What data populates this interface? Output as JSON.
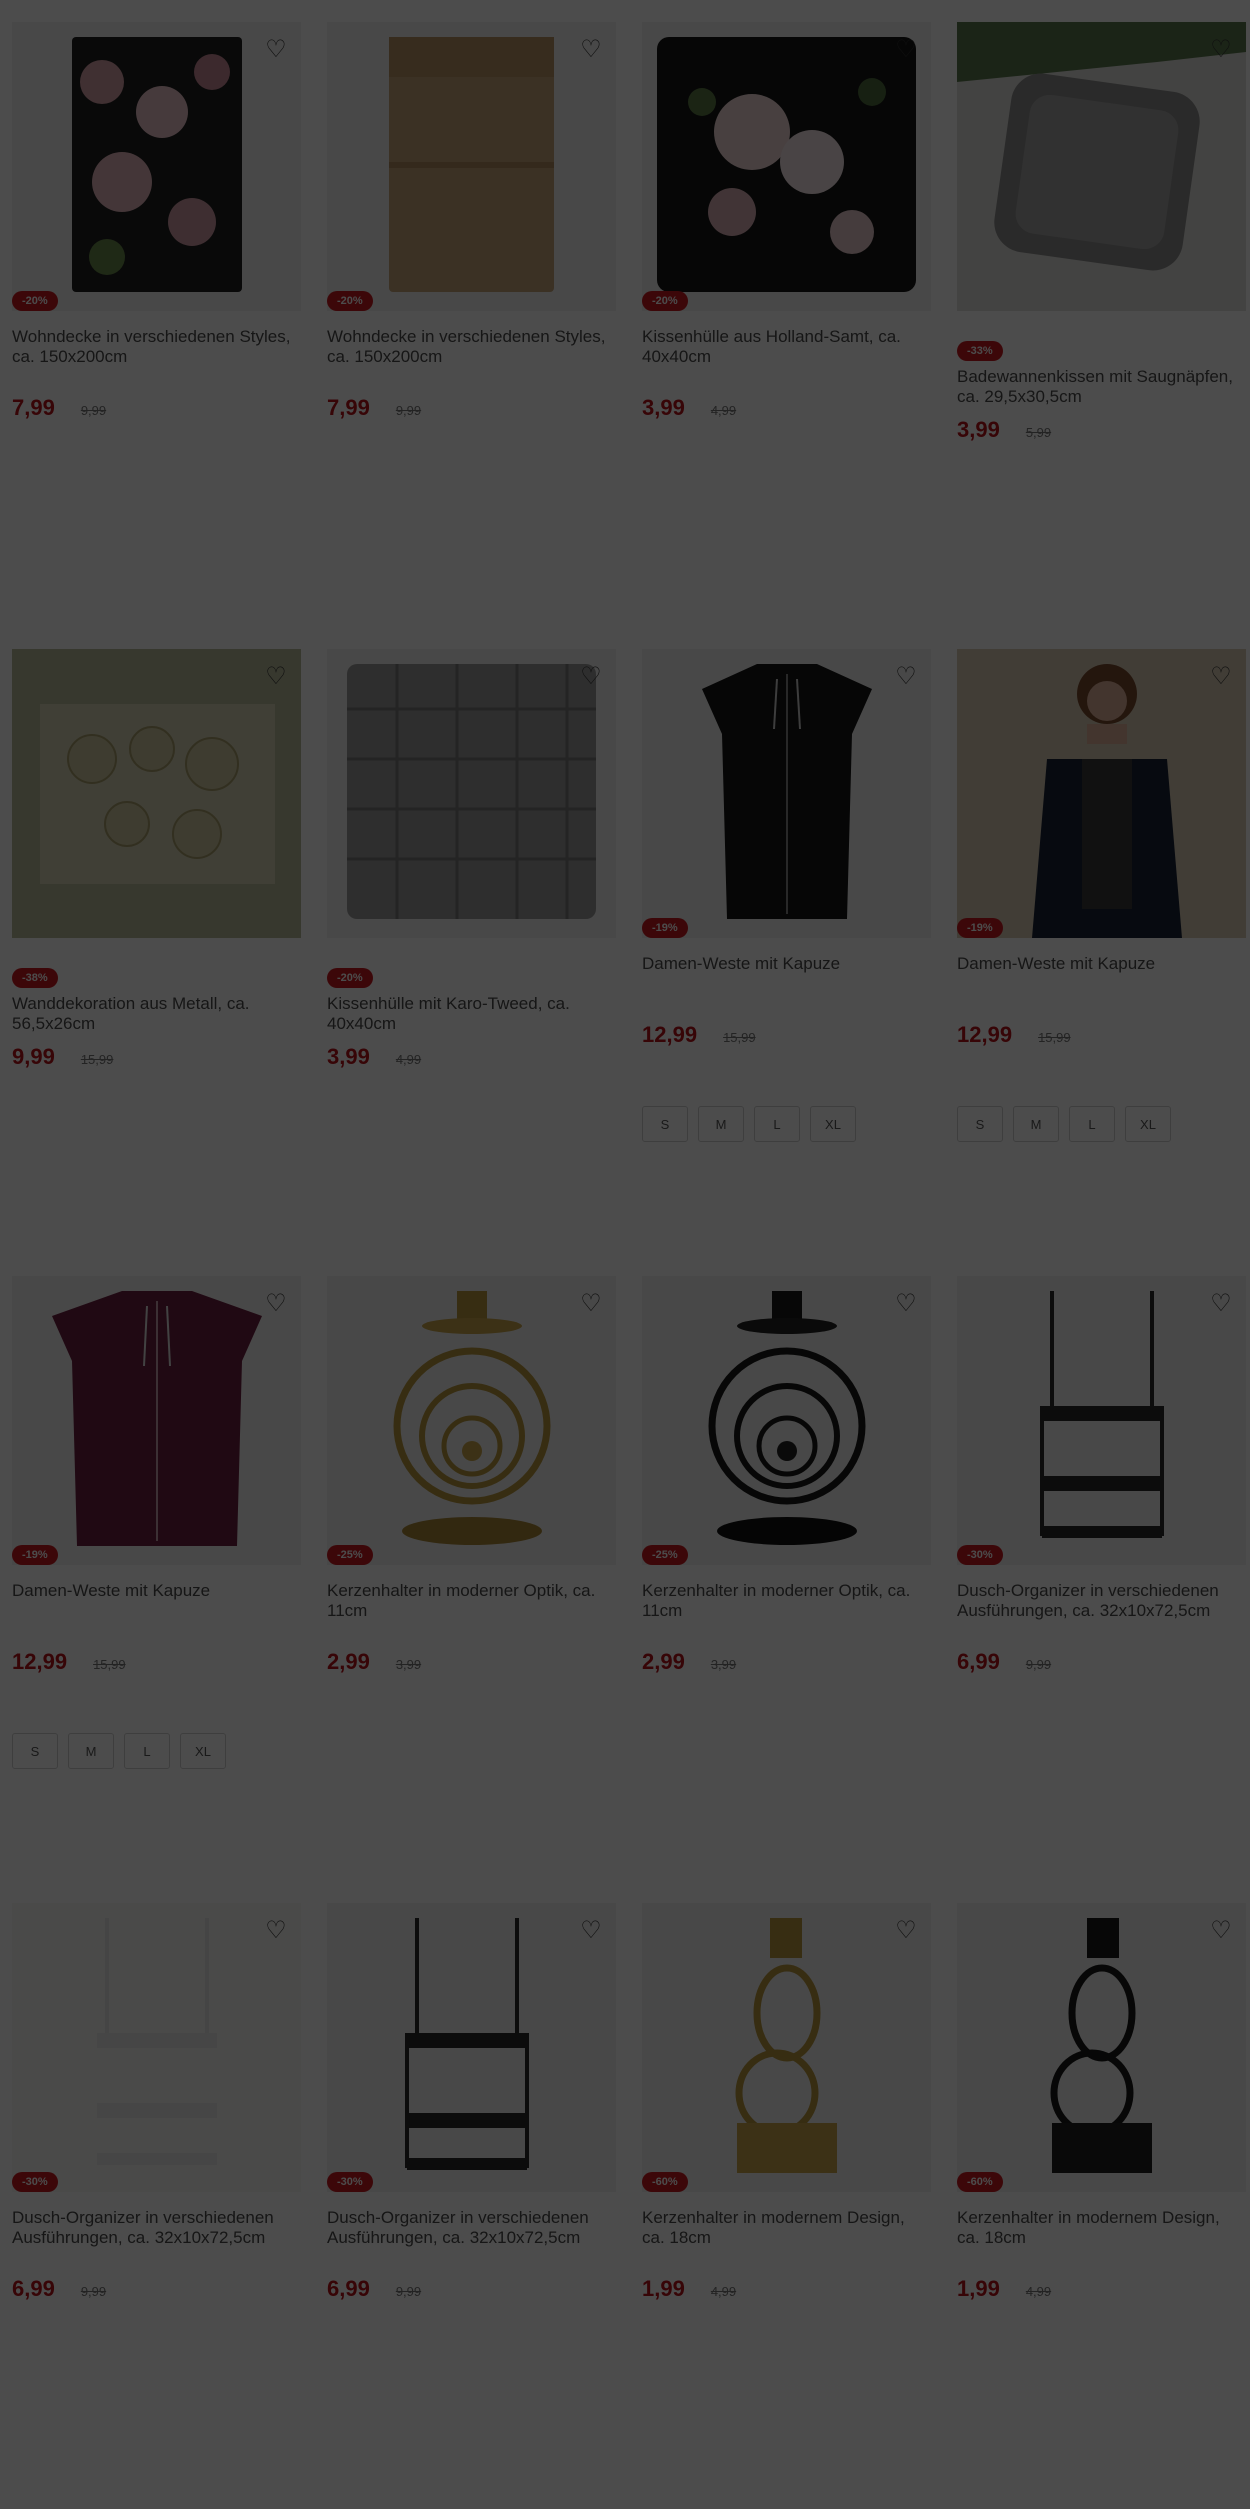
{
  "products": [
    {
      "title": "Wohndecke in verschiedenen Styles, ca. 150x200cm",
      "discount": "-20%",
      "price": "7,99",
      "old_price": "9,99",
      "sizes": []
    },
    {
      "title": "Wohndecke in verschiedenen Styles, ca. 150x200cm",
      "discount": "-20%",
      "price": "7,99",
      "old_price": "9,99",
      "sizes": []
    },
    {
      "title": "Kissenhülle aus Holland-Samt, ca. 40x40cm",
      "discount": "-20%",
      "price": "3,99",
      "old_price": "4,99",
      "sizes": []
    },
    {
      "title": "Badewannenkissen mit Saugnäpfen, ca. 29,5x30,5cm",
      "discount": "-33%",
      "price": "3,99",
      "old_price": "5,99",
      "sizes": []
    },
    {
      "title": "Wanddekoration aus Metall, ca. 56,5x26cm",
      "discount": "-38%",
      "price": "9,99",
      "old_price": "15,99",
      "sizes": []
    },
    {
      "title": "Kissenhülle mit Karo-Tweed, ca. 40x40cm",
      "discount": "-20%",
      "price": "3,99",
      "old_price": "4,99",
      "sizes": []
    },
    {
      "title": "Damen-Weste mit Kapuze",
      "discount": "-19%",
      "price": "12,99",
      "old_price": "15,99",
      "sizes": [
        "S",
        "M",
        "L",
        "XL"
      ]
    },
    {
      "title": "Damen-Weste mit Kapuze",
      "discount": "-19%",
      "price": "12,99",
      "old_price": "15,99",
      "sizes": [
        "S",
        "M",
        "L",
        "XL"
      ]
    },
    {
      "title": "Damen-Weste mit Kapuze",
      "discount": "-19%",
      "price": "12,99",
      "old_price": "15,99",
      "sizes": [
        "S",
        "M",
        "L",
        "XL"
      ]
    },
    {
      "title": "Kerzenhalter in moderner Optik, ca. 11cm",
      "discount": "-25%",
      "price": "2,99",
      "old_price": "3,99",
      "sizes": []
    },
    {
      "title": "Kerzenhalter in moderner Optik, ca. 11cm",
      "discount": "-25%",
      "price": "2,99",
      "old_price": "3,99",
      "sizes": []
    },
    {
      "title": "Dusch-Organizer in verschiedenen Ausführungen, ca. 32x10x72,5cm",
      "discount": "-30%",
      "price": "6,99",
      "old_price": "9,99",
      "sizes": []
    },
    {
      "title": "Dusch-Organizer in verschiedenen Ausführungen, ca. 32x10x72,5cm",
      "discount": "-30%",
      "price": "6,99",
      "old_price": "9,99",
      "sizes": []
    },
    {
      "title": "Dusch-Organizer in verschiedenen Ausführungen, ca. 32x10x72,5cm",
      "discount": "-30%",
      "price": "6,99",
      "old_price": "9,99",
      "sizes": []
    },
    {
      "title": "Kerzenhalter in modernem Design, ca. 18cm",
      "discount": "-60%",
      "price": "1,99",
      "old_price": "4,99",
      "sizes": []
    },
    {
      "title": "Kerzenhalter in modernem Design, ca. 18cm",
      "discount": "-60%",
      "price": "1,99",
      "old_price": "4,99",
      "sizes": []
    }
  ],
  "icons": {
    "wishlist": "heart-outline-icon"
  },
  "colors": {
    "accent": "#c8191e",
    "price": "#b8121a",
    "overlay": "rgba(0,0,0,0.7)"
  }
}
